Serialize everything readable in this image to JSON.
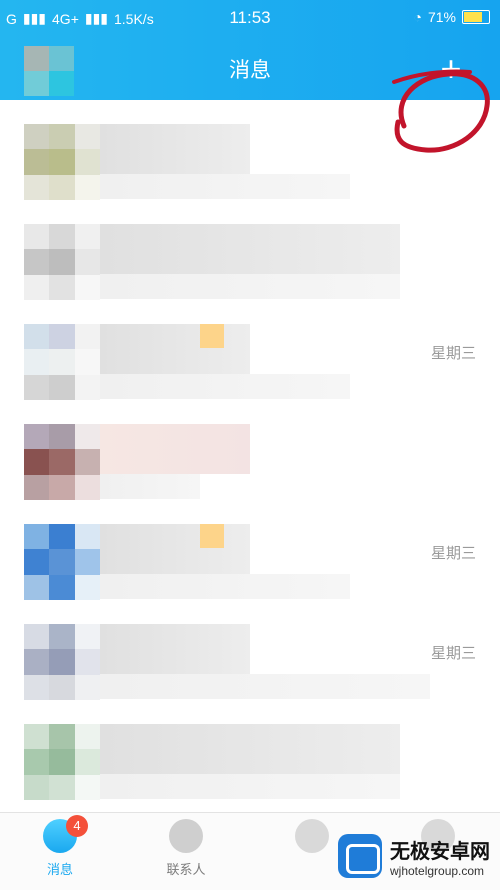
{
  "statusbar": {
    "signal_left": "G",
    "network": "4G+",
    "speed": "1.5K/s",
    "time": "11:53",
    "battery": "71%"
  },
  "header": {
    "title": "消息",
    "plus": "+"
  },
  "messages": [
    {
      "time": ""
    },
    {
      "time": ""
    },
    {
      "time": "星期三"
    },
    {
      "time": ""
    },
    {
      "time": "星期三"
    },
    {
      "time": "星期三"
    },
    {
      "time": ""
    }
  ],
  "tabs": [
    {
      "label": "消息",
      "badge": "4"
    },
    {
      "label": "联系人"
    },
    {
      "label": ""
    },
    {
      "label": ""
    }
  ],
  "watermark": {
    "title": "无极安卓网",
    "url": "wjhotelgroup.com"
  },
  "colors": {
    "primary": "#1aa8ef",
    "badge": "#f4503a",
    "annotation": "#c2142b"
  },
  "icons": [
    "wifi-icon",
    "battery-icon",
    "plus-icon",
    "avatar-icon",
    "contacts-icon"
  ]
}
